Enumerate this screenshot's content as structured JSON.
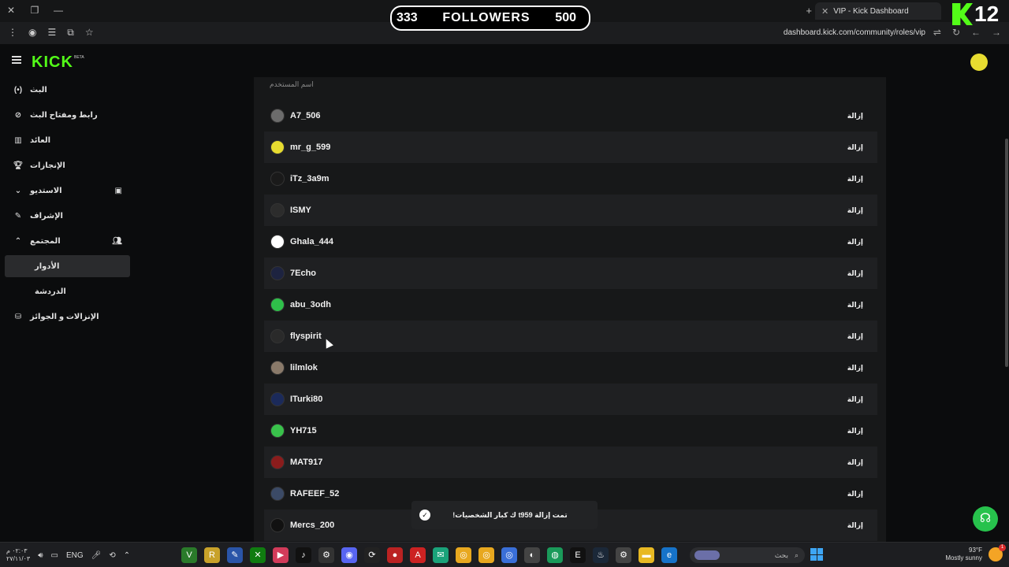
{
  "browser": {
    "tab_title": "VIP - Kick Dashboard",
    "tab_close": "✕",
    "new_tab": "+",
    "url": "dashboard.kick.com/community/roles/vip"
  },
  "overlay": {
    "followers_current": "333",
    "followers_label": "FOLLOWERS",
    "followers_goal": "500",
    "channel_number": "12"
  },
  "header": {
    "brand": "KICK",
    "brand_badge": "BETA"
  },
  "sidebar": {
    "items": [
      {
        "label": "البث",
        "icon": "live-icon"
      },
      {
        "label": "رابط ومفتاح البث",
        "icon": "link-icon"
      },
      {
        "label": "العائد",
        "icon": "chart-icon"
      },
      {
        "label": "الإنجازات",
        "icon": "trophy-icon"
      },
      {
        "label": "الاستديو",
        "icon": "chevron-down-icon"
      },
      {
        "label": "الإشراف",
        "icon": "wrench-icon"
      },
      {
        "label": "المجتمع",
        "icon": "chevron-up-icon"
      },
      {
        "label": "الأدوار",
        "icon": ""
      },
      {
        "label": "الدردشة",
        "icon": ""
      },
      {
        "label": "الإنزالات و الجوائز",
        "icon": "gift-icon"
      }
    ]
  },
  "table": {
    "column_username": "اسم المستخدم",
    "remove_label": "إزالة",
    "rows": [
      {
        "username": "A7_506",
        "avatar_color": "#6c6c6c"
      },
      {
        "username": "mr_g_599",
        "avatar_color": "#e7dc30"
      },
      {
        "username": "iTz_3a9m",
        "avatar_color": "#1a1a1a"
      },
      {
        "username": "ISMY",
        "avatar_color": "#2c2c2c"
      },
      {
        "username": "Ghala_444",
        "avatar_color": "#ffffff"
      },
      {
        "username": "7Echo",
        "avatar_color": "#1d2340"
      },
      {
        "username": "abu_3odh",
        "avatar_color": "#2fbf4a"
      },
      {
        "username": "flyspirit",
        "avatar_color": "#2a2a2a"
      },
      {
        "username": "lilmlok",
        "avatar_color": "#8a7a6a"
      },
      {
        "username": "ITurki80",
        "avatar_color": "#1b2a5a"
      },
      {
        "username": "YH715",
        "avatar_color": "#39c24b"
      },
      {
        "username": "MAT917",
        "avatar_color": "#8a1c1c"
      },
      {
        "username": "RAFEEF_52",
        "avatar_color": "#3b4a66"
      },
      {
        "username": "Mercs_200",
        "avatar_color": "#111111"
      }
    ]
  },
  "toast": {
    "message": "!ك كبار الشخصيات t959 تمت إزالة"
  },
  "taskbar": {
    "time": "٠٢:٠٣ م",
    "date": "٢٧/١١/٠٣",
    "language": "ENG",
    "search_placeholder": "بحث",
    "weather_temp": "93°F",
    "weather_desc": "Mostly sunny",
    "notification_count": "1"
  }
}
